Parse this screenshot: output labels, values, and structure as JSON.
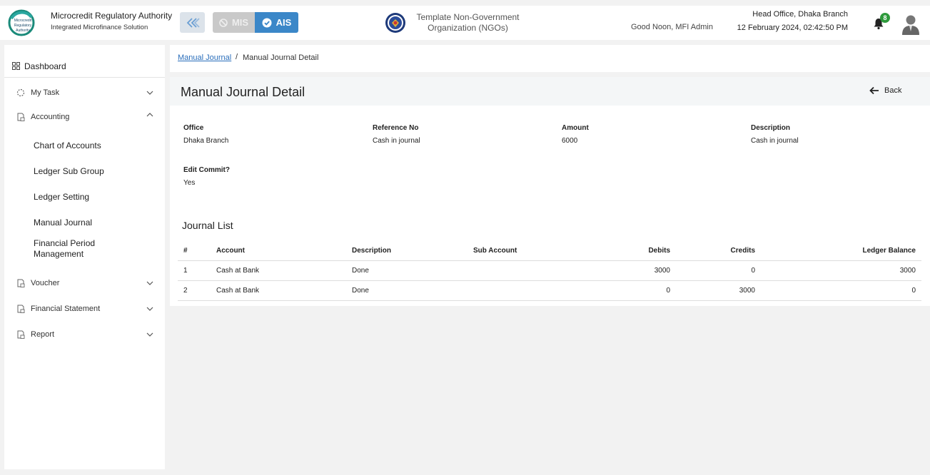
{
  "header": {
    "brand_title": "Microcredit Regulatory Authority",
    "brand_subtitle": "Integrated Microfinance Solution",
    "logo_text": [
      "Microcredit",
      "Regulatory",
      "Authority"
    ],
    "mis_label": "MIS",
    "ais_label": "AIS",
    "org_name_line1": "Template Non-Government",
    "org_name_line2": "Organization (NGOs)",
    "greeting": "Good Noon, MFI Admin",
    "branch": "Head Office, Dhaka Branch",
    "datetime": "12 February 2024, 02:42:50 PM",
    "notification_count": "8",
    "accent_color": "#3b87c8",
    "badge_color": "#2e9a3c"
  },
  "sidebar": {
    "dashboard": "Dashboard",
    "items": [
      {
        "label": "My Task",
        "icon": "spinner-icon",
        "expanded": false
      },
      {
        "label": "Accounting",
        "icon": "document-icon",
        "expanded": true
      },
      {
        "label": "Voucher",
        "icon": "document-icon",
        "expanded": false
      },
      {
        "label": "Financial Statement",
        "icon": "document-icon",
        "expanded": false
      },
      {
        "label": "Report",
        "icon": "document-icon",
        "expanded": false
      }
    ],
    "accounting_sub": [
      "Chart of Accounts",
      "Ledger Sub Group",
      "Ledger Setting",
      "Manual Journal",
      "Financial Period Management"
    ]
  },
  "breadcrumb": {
    "link": "Manual Journal",
    "separator": "/",
    "current": "Manual Journal Detail"
  },
  "detail": {
    "title": "Manual Journal Detail",
    "back_label": "Back",
    "fields": [
      {
        "label": "Office",
        "value": "Dhaka Branch"
      },
      {
        "label": "Reference No",
        "value": "Cash in journal"
      },
      {
        "label": "Amount",
        "value": "6000"
      },
      {
        "label": "Description",
        "value": "Cash in journal"
      },
      {
        "label": "Edit Commit?",
        "value": "Yes"
      }
    ]
  },
  "journal": {
    "title": "Journal List",
    "columns": [
      "#",
      "Account",
      "Description",
      "Sub Account",
      "Debits",
      "Credits",
      "Ledger Balance"
    ],
    "rows": [
      [
        "1",
        "Cash at Bank",
        "Done",
        "",
        "3000",
        "0",
        "3000"
      ],
      [
        "2",
        "Cash at Bank",
        "Done",
        "",
        "0",
        "3000",
        "0"
      ]
    ]
  }
}
